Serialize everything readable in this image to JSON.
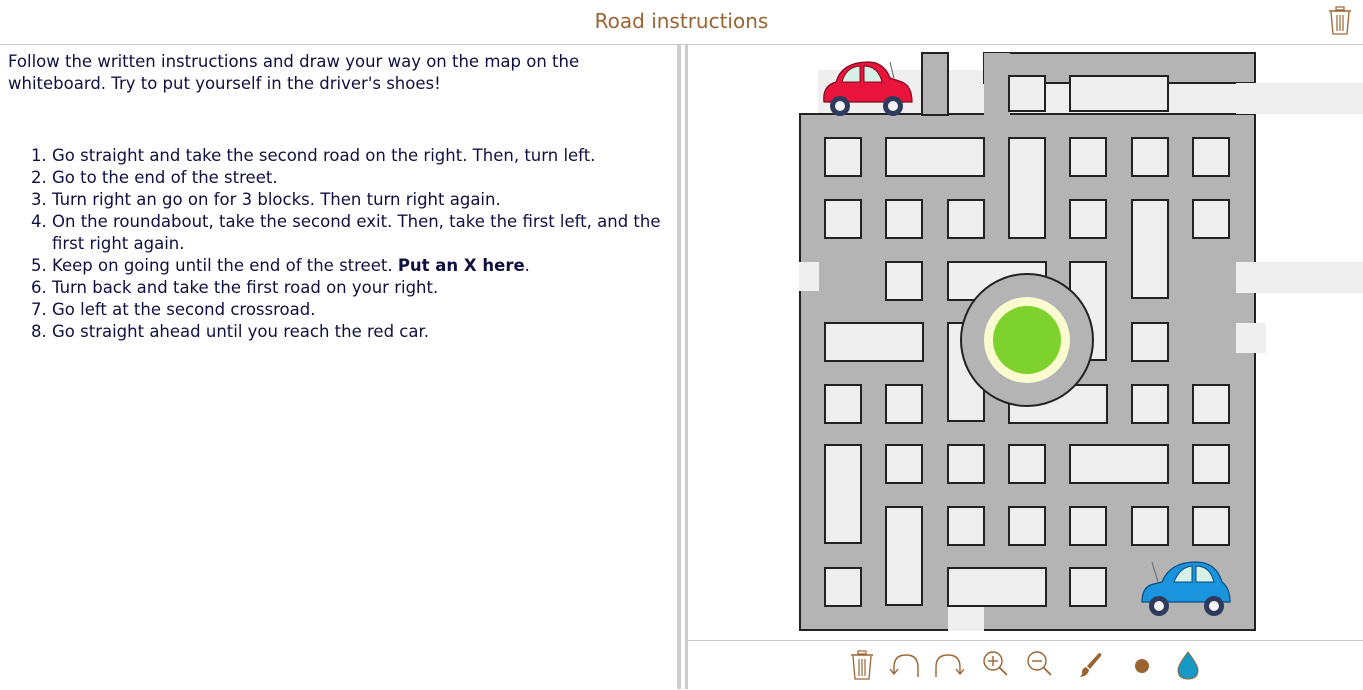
{
  "header": {
    "title": "Road instructions",
    "trash_icon": "trash-icon"
  },
  "instructions": {
    "intro": "Follow the written instructions and draw your way on the map on the whiteboard. Try to put yourself in the driver's shoes!",
    "steps": [
      {
        "text": "Go straight and take the second road on the right. Then, turn left."
      },
      {
        "text": "Go to the end of the street."
      },
      {
        "text": "Turn right an go on for 3 blocks. Then turn right again."
      },
      {
        "text": "On the roundabout, take the second exit. Then, take the first left, and the first right again."
      },
      {
        "text": "Keep on going until the end of the street. ",
        "bold": "Put an X here",
        "after": "."
      },
      {
        "text": "Turn back and take the first road on your right."
      },
      {
        "text": "Go left at the second crossroad."
      },
      {
        "text": "Go straight ahead until you reach the red car."
      }
    ]
  },
  "map": {
    "road_color": "#b4b4b4",
    "block_color": "#efefef",
    "roundabout_center_color": "#7ed22e",
    "roundabout_ring_color": "#fafcd0",
    "red_car_color": "#e8143c",
    "blue_car_color": "#1a94dc"
  },
  "toolbar": {
    "tools": [
      {
        "name": "trash-icon"
      },
      {
        "name": "undo-icon"
      },
      {
        "name": "redo-icon"
      },
      {
        "name": "zoom-in-icon"
      },
      {
        "name": "zoom-out-icon"
      },
      {
        "name": "brush-icon"
      },
      {
        "name": "brush-size-icon"
      },
      {
        "name": "color-drop-icon"
      }
    ],
    "accent_color": "#9a6432",
    "drop_color": "#1699c4"
  }
}
